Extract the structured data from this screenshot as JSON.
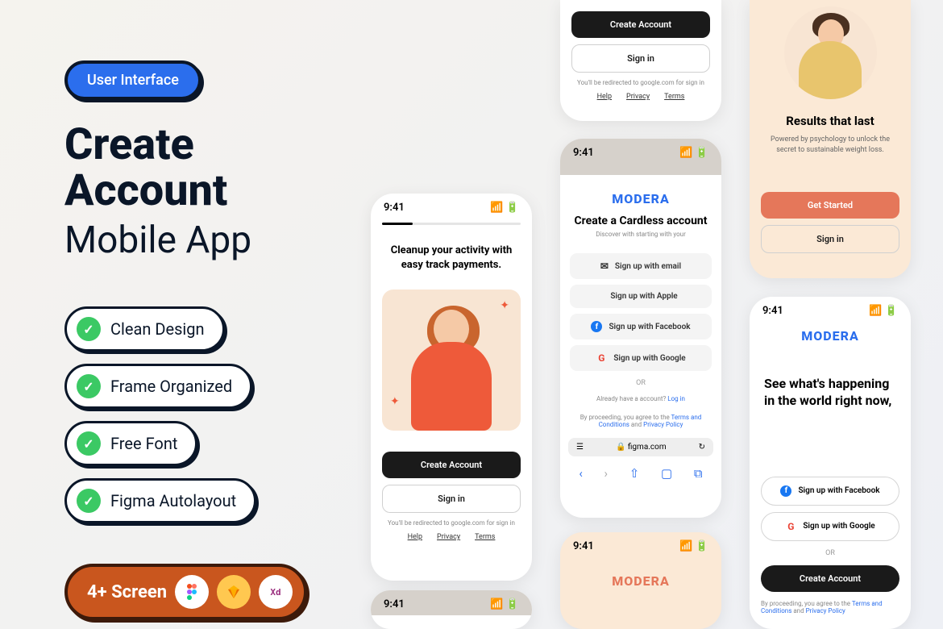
{
  "badge": "User Interface",
  "title": "Create Account",
  "subtitle": "Mobile App",
  "pills": [
    "Clean Design",
    "Frame Organized",
    "Free Font",
    "Figma Autolayout"
  ],
  "screenBadge": "4+ Screen",
  "time": "9:41",
  "p1": {
    "heading": "Cleanup your activity with easy track payments.",
    "create": "Create Account",
    "signin": "Sign in",
    "redirect": "You'll be redirected to google.com for sign in",
    "links": {
      "help": "Help",
      "privacy": "Privacy",
      "terms": "Terms"
    }
  },
  "p2t": {
    "create": "Create Account",
    "signin": "Sign in",
    "redirect": "You'll be redirected to google.com for sign in"
  },
  "p2": {
    "logo": "MODERA",
    "title": "Create a Cardless account",
    "sub": "Discover with starting with your",
    "email": "Sign up with email",
    "apple": "Sign up with Apple",
    "facebook": "Sign up with Facebook",
    "google": "Sign up with Google",
    "or": "OR",
    "already": "Already have a account? ",
    "login": "Log in",
    "proceed": "By proceeding, you agree to the ",
    "terms": "Terms and Conditions",
    "and": " and ",
    "privacy": "Privacy Policy",
    "url": "figma.com"
  },
  "p3t": {
    "title": "Results that last",
    "sub": "Powered by psychology to unlock the secret to sustainable weight loss.",
    "get": "Get Started",
    "signin": "Sign in"
  },
  "p3": {
    "logo": "MODERA",
    "heading": "See what's happening in the world right now,",
    "facebook": "Sign up with Facebook",
    "google": "Sign up with Google",
    "or": "OR",
    "create": "Create Account",
    "proceed": "By proceeding, you agree to the ",
    "terms": "Terms and Conditions",
    "and": " and ",
    "privacy": "Privacy Policy"
  }
}
